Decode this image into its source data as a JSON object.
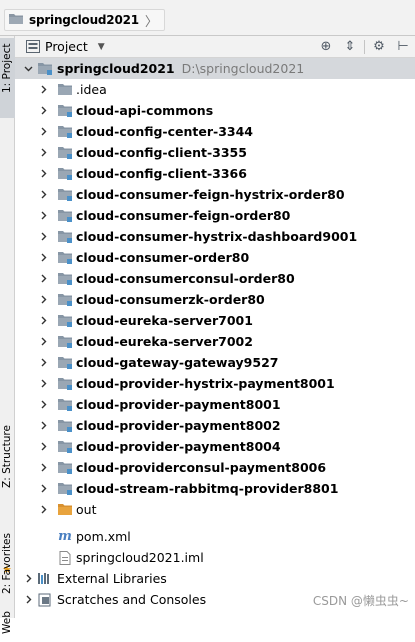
{
  "breadcrumb": {
    "project": "springcloud2021",
    "separator": "〉"
  },
  "tool_strip": {
    "project_tab": "1: Project",
    "structure_tab": "Z: Structure",
    "favorites_tab": "2: Favorites",
    "web_tab": "Web"
  },
  "panel": {
    "title": "Project",
    "dropdown": "▼"
  },
  "tree": {
    "root": {
      "name": "springcloud2021",
      "path": "D:\\springcloud2021"
    },
    "folders": [
      ".idea",
      "cloud-api-commons",
      "cloud-config-center-3344",
      "cloud-config-client-3355",
      "cloud-config-client-3366",
      "cloud-consumer-feign-hystrix-order80",
      "cloud-consumer-feign-order80",
      "cloud-consumer-hystrix-dashboard9001",
      "cloud-consumer-order80",
      "cloud-consumerconsul-order80",
      "cloud-consumerzk-order80",
      "cloud-eureka-server7001",
      "cloud-eureka-server7002",
      "cloud-gateway-gateway9527",
      "cloud-provider-hystrix-payment8001",
      "cloud-provider-payment8001",
      "cloud-provider-payment8002",
      "cloud-provider-payment8004",
      "cloud-providerconsul-payment8006",
      "cloud-stream-rabbitmq-provider8801",
      "out"
    ],
    "files": [
      "pom.xml",
      "springcloud2021.iml"
    ],
    "external_libraries": "External Libraries",
    "scratches": "Scratches and Consoles"
  },
  "watermark": "CSDN @懒虫虫~",
  "colors": {
    "selection": "#d5d8dc",
    "module_blue": "#4a90c8",
    "folder_orange": "#e8a33d"
  }
}
